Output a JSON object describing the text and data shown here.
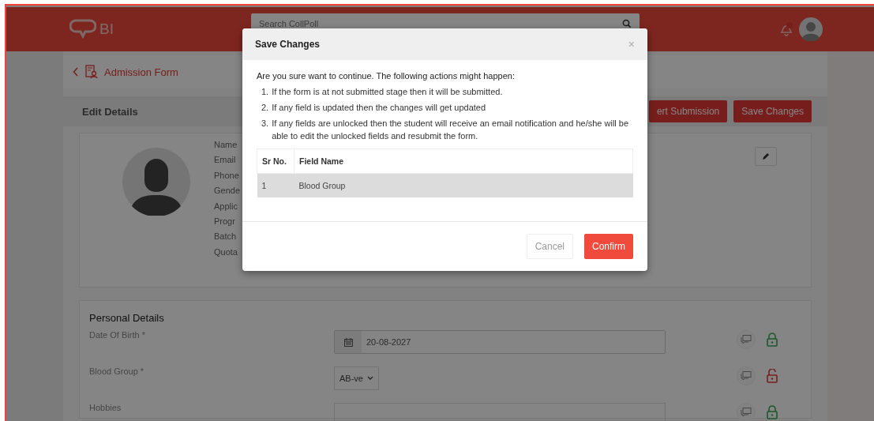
{
  "header": {
    "logo_text": "BI",
    "search": {
      "placeholder": "Search CollPoll"
    }
  },
  "breadcrumb": {
    "title": "Admission Form"
  },
  "edit_bar": {
    "title": "Edit Details",
    "buttons": [
      "ert Submission",
      "Save Changes"
    ]
  },
  "profile": {
    "labels": [
      "Name",
      "Email",
      "Phone",
      "Gende",
      "Applic",
      "Progr",
      "Batch",
      "Quota"
    ]
  },
  "personal_details": {
    "title": "Personal Details",
    "fields": [
      {
        "kind": "date",
        "label": "Date Of Birth *",
        "value": "20-08-2027",
        "unlocked": false
      },
      {
        "kind": "select",
        "label": "Blood Group *",
        "value": "AB-ve",
        "unlocked": true
      },
      {
        "kind": "text",
        "label": "Hobbies",
        "unlocked": false
      }
    ]
  },
  "modal": {
    "title": "Save Changes",
    "close": "×",
    "intro": "Are you sure want to continue. The following actions might happen:",
    "items": [
      {
        "num": "1.",
        "text": "If the form is at not submitted stage then it will be submitted."
      },
      {
        "num": "2.",
        "text": "If any field is updated then the changes will get updated"
      },
      {
        "num": "3.",
        "text": "If any fields are unlocked then the student will receive an email notification and he/she will be able to edit the unlocked fields and resubmit the form."
      }
    ],
    "table": {
      "columns": [
        "Sr No.",
        "Field Name"
      ],
      "rows": [
        [
          "1",
          "Blood Group"
        ]
      ]
    },
    "buttons": [
      {
        "label": "Cancel",
        "kind": "secondary"
      },
      {
        "label": "Confirm",
        "kind": "primary"
      }
    ]
  }
}
